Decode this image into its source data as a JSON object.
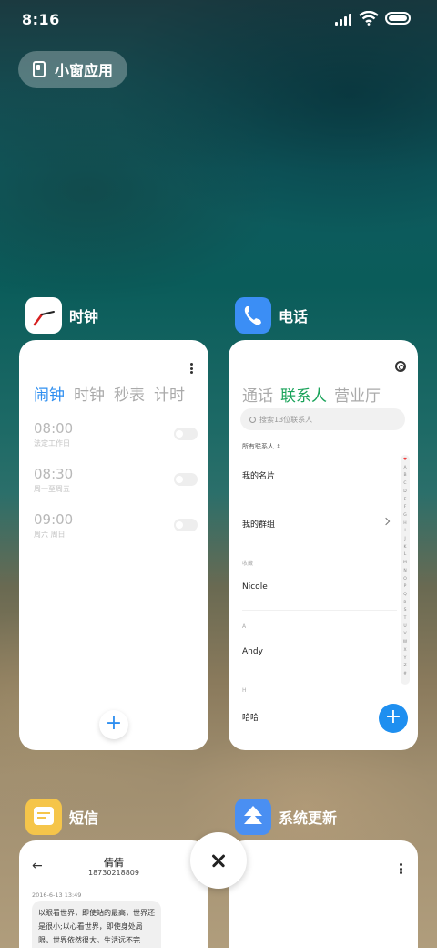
{
  "status_bar": {
    "time": "8:16",
    "signal_icon": "signal-icon",
    "wifi_icon": "wifi-icon",
    "battery_icon": "battery-icon"
  },
  "small_window": {
    "label": "小窗应用",
    "icon": "small-window-icon"
  },
  "apps": {
    "clock": {
      "name": "时钟",
      "tabs": [
        "闹钟",
        "时钟",
        "秒表",
        "计时"
      ],
      "alarms": [
        {
          "time": "08:00",
          "desc": "法定工作日"
        },
        {
          "time": "08:30",
          "desc": "周一至周五"
        },
        {
          "time": "09:00",
          "desc": "周六 周日"
        }
      ],
      "add_label": "+"
    },
    "phone": {
      "name": "电话",
      "tabs": [
        "通话",
        "联系人",
        "营业厅"
      ],
      "search_placeholder": "搜索13位联系人",
      "all_contacts": "所有联系人 ⇕",
      "my_card": "我的名片",
      "my_groups": "我的群组",
      "favorites_label": "收藏",
      "favorite_contact": "Nicole",
      "section_a": "A",
      "contact_a": "Andy",
      "section_h": "H",
      "contact_h": "哈哈",
      "alpha_index": [
        "♥",
        "A",
        "B",
        "C",
        "D",
        "E",
        "F",
        "G",
        "H",
        "I",
        "J",
        "K",
        "L",
        "M",
        "N",
        "O",
        "P",
        "Q",
        "R",
        "S",
        "T",
        "U",
        "V",
        "W",
        "X",
        "Y",
        "Z",
        "#"
      ],
      "add_label": "+"
    },
    "sms": {
      "name": "短信",
      "contact_name": "倩倩",
      "contact_number": "18730218809",
      "date": "2016-6-13 13:49",
      "message": "以眼看世界，即使站的最高，世界还是很小;以心看世界，即使身处局限，世界依然很大。生活远不完"
    },
    "update": {
      "name": "系统更新"
    }
  },
  "colors": {
    "clock_accent": "#2f8ff0",
    "phone_accent": "#1aa35a",
    "phone_icon_bg": "#3b8ef5",
    "sms_icon_bg": "#f5c54a",
    "update_icon_bg": "#4a8ff2"
  }
}
